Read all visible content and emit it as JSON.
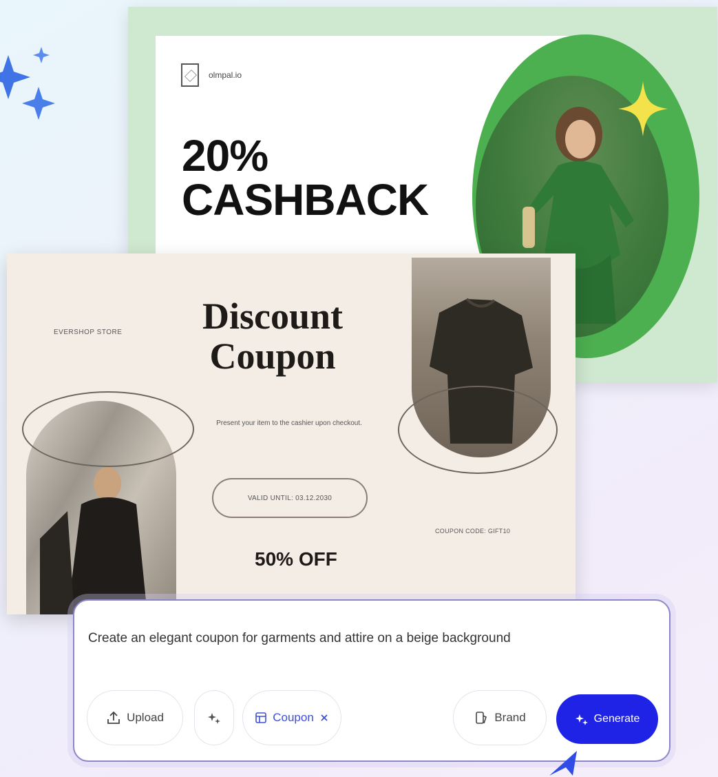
{
  "cashback_card": {
    "brand_name": "olmpal.io",
    "headline": "20% CASHBACK"
  },
  "coupon_card": {
    "store_name": "EVERSHOP STORE",
    "title": "Discount Coupon",
    "subtitle": "Present your item to the cashier upon checkout.",
    "valid_until": "VALID UNTIL: 03.12.2030",
    "coupon_code": "COUPON CODE: GIFT10",
    "offer": "50% OFF"
  },
  "composer": {
    "prompt": "Create an elegant coupon for garments and attire on a beige background",
    "upload_label": "Upload",
    "chip_label": "Coupon",
    "brand_label": "Brand",
    "generate_label": "Generate"
  },
  "colors": {
    "accent_blue": "#1f23e6",
    "green": "#4caf50",
    "beige": "#f4ede6",
    "sparkle_blue": "#3f73e6",
    "star_yellow": "#f4e24a"
  }
}
